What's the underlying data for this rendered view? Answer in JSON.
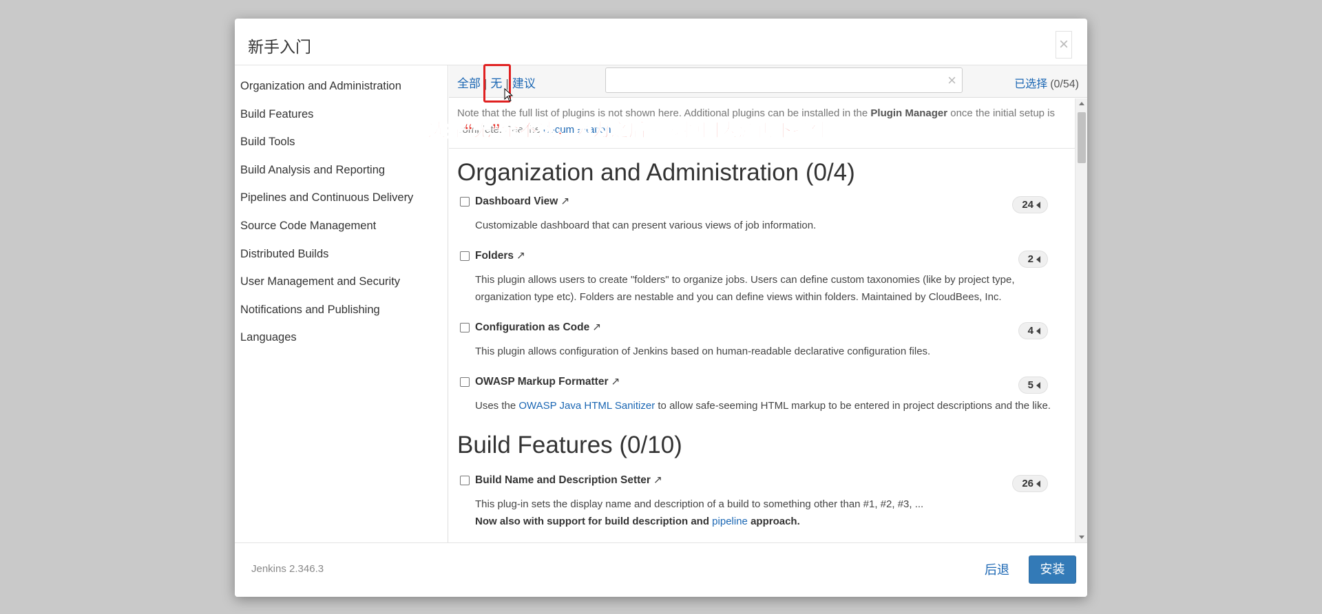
{
  "dialog": {
    "title": "新手入门",
    "close_glyph": "×"
  },
  "sidebar": {
    "items": [
      {
        "label": "Organization and Administration"
      },
      {
        "label": "Build Features"
      },
      {
        "label": "Build Tools"
      },
      {
        "label": "Build Analysis and Reporting"
      },
      {
        "label": "Pipelines and Continuous Delivery"
      },
      {
        "label": "Source Code Management"
      },
      {
        "label": "Distributed Builds"
      },
      {
        "label": "User Management and Security"
      },
      {
        "label": "Notifications and Publishing"
      },
      {
        "label": "Languages"
      }
    ]
  },
  "toolbar": {
    "all_label": "全部",
    "none_label": "无",
    "suggested_label": "建议",
    "separator": "|",
    "search_value": "",
    "search_clear": "×",
    "selected_label": "已选择",
    "selected_count": "(0/54)"
  },
  "note": {
    "text_before": "Note that the full list of plugins is not shown here. Additional plugins can be installed in the",
    "plugin_manager": "Plugin Manager",
    "text_after": "once the initial setup is complete. See the",
    "doc_link": "documentation"
  },
  "annotation": {
    "text": "选择“无”全不选，因为之后需要换国内源再下插件",
    "color": "#e4231b"
  },
  "categories": [
    {
      "heading": "Organization and Administration (0/4)",
      "plugins": [
        {
          "name": "Dashboard View",
          "ext": "↗",
          "count": "24",
          "desc": "Customizable dashboard that can present various views of job information."
        },
        {
          "name": "Folders",
          "ext": "↗",
          "count": "2",
          "desc": "This plugin allows users to create \"folders\" to organize jobs. Users can define custom taxonomies (like by project type, organization type etc). Folders are nestable and you can define views within folders. Maintained by CloudBees, Inc."
        },
        {
          "name": "Configuration as Code",
          "ext": "↗",
          "count": "4",
          "desc": "This plugin allows configuration of Jenkins based on human-readable declarative configuration files."
        },
        {
          "name": "OWASP Markup Formatter",
          "ext": "↗",
          "count": "5",
          "desc_before": "Uses the",
          "desc_link": "OWASP Java HTML Sanitizer",
          "desc_after": "to allow safe-seeming HTML markup to be entered in project descriptions and the like."
        }
      ]
    },
    {
      "heading": "Build Features (0/10)",
      "plugins": [
        {
          "name": "Build Name and Description Setter",
          "ext": "↗",
          "count": "26",
          "desc": "This plug-in sets the display name and description of a build to something other than #1, #2, #3, ...",
          "desc2_before": "Now also with support for build description and",
          "desc2_link": "pipeline",
          "desc2_after": "approach."
        }
      ]
    }
  ],
  "footer": {
    "version": "Jenkins 2.346.3",
    "back_label": "后退",
    "install_label": "安装"
  },
  "colors": {
    "link": "#1a66b3",
    "primary_button": "#337ab7",
    "highlight": "#e02020",
    "backdrop": "#c9c9c9"
  }
}
